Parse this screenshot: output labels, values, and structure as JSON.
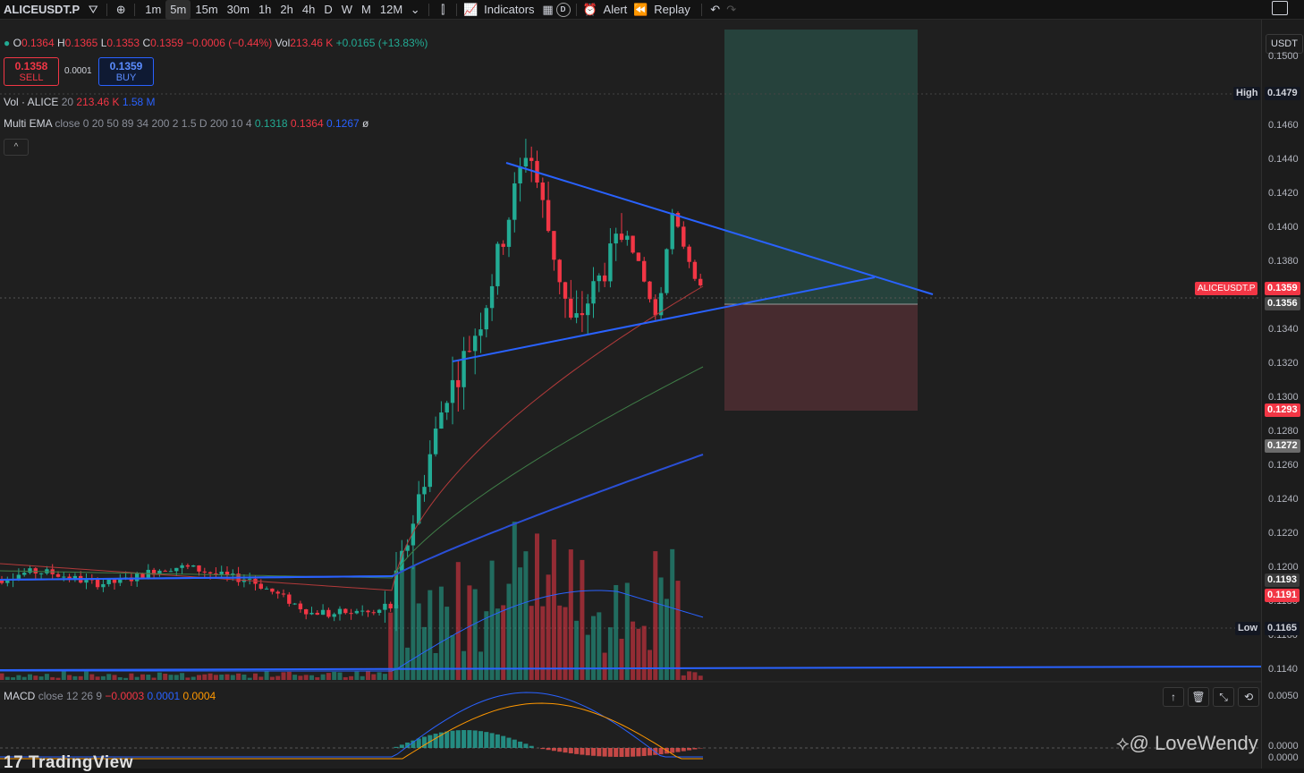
{
  "toolbar": {
    "symbol": "ALICEUSDT.P",
    "timeframes": [
      "1m",
      "5m",
      "15m",
      "30m",
      "1h",
      "2h",
      "4h",
      "D",
      "W",
      "M",
      "12M"
    ],
    "active_timeframe": "5m",
    "indicators_label": "Indicators",
    "d_badge": "D",
    "alert_label": "Alert",
    "replay_label": "Replay"
  },
  "ohlc": {
    "o_label": "O",
    "o": "0.1364",
    "h_label": "H",
    "h": "0.1365",
    "l_label": "L",
    "l": "0.1353",
    "c_label": "C",
    "c": "0.1359",
    "change": "−0.0006 (−0.44%)",
    "vol_label": "Vol",
    "vol": "213.46 K",
    "vol_change": "+0.0165 (+13.83%)"
  },
  "trade": {
    "sell_price": "0.1358",
    "sell_label": "SELL",
    "spread": "0.0001",
    "buy_price": "0.1359",
    "buy_label": "BUY"
  },
  "volume_legend": {
    "name": "Vol · ALICE",
    "length": "20",
    "value": "213.46 K",
    "ma": "1.58 M"
  },
  "ema_legend": {
    "name": "Multi EMA",
    "params": "close 0 20 50 89 34 200 2 1.5 D 200 10 4",
    "v1": "0.1318",
    "v2": "0.1364",
    "v3": "0.1267",
    "v4": "ø"
  },
  "collapse_glyph": "^",
  "macd_legend": {
    "name": "MACD",
    "params": "close 12 26 9",
    "v1": "−0.0003",
    "v2": "0.0001",
    "v3": "0.0004"
  },
  "price_axis": {
    "currency": "USDT",
    "labels": [
      "0.1500",
      "0.1460",
      "0.1440",
      "0.1420",
      "0.1400",
      "0.1380",
      "0.1340",
      "0.1320",
      "0.1300",
      "0.1280",
      "0.1260",
      "0.1240",
      "0.1220",
      "0.1200",
      "0.1180",
      "0.1160",
      "0.1140",
      "0.0050",
      "0.0000",
      "0.0000"
    ],
    "high_label": "High",
    "high_value": "0.1479",
    "low_label": "Low",
    "low_value": "0.1165",
    "symbol_tag": "ALICEUSDT.P",
    "last_price": "0.1359",
    "line_price": "0.1356",
    "stop_price": "0.1293",
    "ema_price": "0.1272",
    "p1193": "0.1193",
    "p1191": "0.1191"
  },
  "pane_buttons": [
    "↑",
    "🗑",
    "⤡",
    "⟲"
  ],
  "watermark": {
    "brand": "TradingView",
    "user": "@ LoveWendy"
  },
  "colors": {
    "up": "#22ab94",
    "down": "#f23645",
    "trend": "#2962ff",
    "ema_red": "#b23a3a",
    "ema_green": "#3f7d47",
    "ema_blue": "#2a4fd6",
    "profit_zone": "#27463f",
    "loss_zone": "#4a2c30"
  }
}
